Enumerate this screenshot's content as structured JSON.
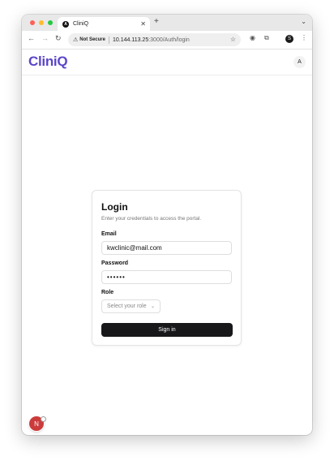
{
  "browser": {
    "tab_title": "CliniQ",
    "tab_favicon": "A",
    "security_label": "Not Secure",
    "url_host": "10.144.113.25",
    "url_path": ":3000/Auth/login",
    "profile_initial": "S"
  },
  "header": {
    "logo": "CliniQ",
    "avatar_initial": "A"
  },
  "login": {
    "title": "Login",
    "subtitle": "Enter your credentials to access the portal.",
    "email_label": "Email",
    "email_value": "kwclinic@mail.com",
    "password_label": "Password",
    "password_value": "••••••",
    "role_label": "Role",
    "role_placeholder": "Select your role",
    "submit_label": "Sign in"
  },
  "badge": {
    "letter": "N"
  },
  "colors": {
    "brand": "#5b46c9",
    "button": "#18181b",
    "badge": "#cc3b3b"
  }
}
